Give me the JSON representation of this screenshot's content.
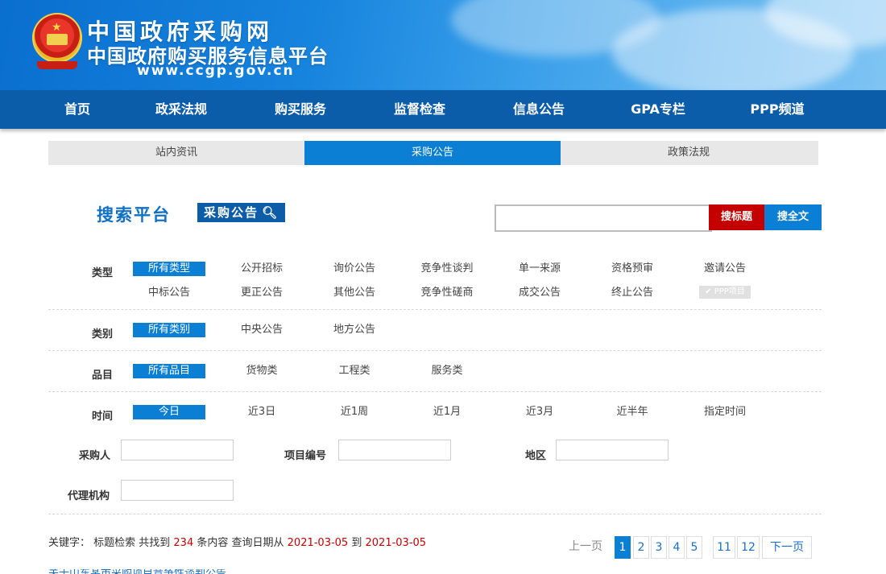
{
  "header": {
    "title": "中国政府采购网",
    "subtitle": "中国政府购买服务信息平台",
    "url": "www.ccgp.gov.cn"
  },
  "nav": [
    "首页",
    "政采法规",
    "购买服务",
    "监督检查",
    "信息公告",
    "GPA专栏",
    "PPP频道"
  ],
  "subtabs": [
    {
      "label": "站内资讯",
      "active": false
    },
    {
      "label": "采购公告",
      "active": true
    },
    {
      "label": "政策法规",
      "active": false
    }
  ],
  "search": {
    "platform_label": "搜索平台",
    "badge_label": "采购公告",
    "input_value": "",
    "btn_title": "搜标题",
    "btn_full": "搜全文"
  },
  "filters": {
    "type": {
      "label": "类型",
      "row1": [
        "所有类型",
        "公开招标",
        "询价公告",
        "竞争性谈判",
        "单一来源",
        "资格预审",
        "邀请公告"
      ],
      "row2": [
        "中标公告",
        "更正公告",
        "其他公告",
        "竞争性磋商",
        "成交公告",
        "终止公告"
      ],
      "ppp_label": "PPP项目"
    },
    "category": {
      "label": "类别",
      "options": [
        "所有类别",
        "中央公告",
        "地方公告"
      ]
    },
    "item": {
      "label": "品目",
      "options": [
        "所有品目",
        "货物类",
        "工程类",
        "服务类"
      ]
    },
    "time": {
      "label": "时间",
      "options": [
        "今日",
        "近3日",
        "近1周",
        "近1月",
        "近3月",
        "近半年",
        "指定时间"
      ]
    }
  },
  "fields": {
    "purchaser": {
      "label": "采购人",
      "value": ""
    },
    "project_no": {
      "label": "项目编号",
      "value": ""
    },
    "region": {
      "label": "地区",
      "value": ""
    },
    "agency": {
      "label": "代理机构",
      "value": ""
    }
  },
  "summary": {
    "prefix": "关键字：  标题检索 共找到",
    "count": "234",
    "mid": "条内容 查询日期从",
    "date_from": "2021-03-05",
    "to": "到",
    "date_to": "2021-03-05"
  },
  "pagination": {
    "prev": "上一页",
    "pages": [
      "1",
      "2",
      "3",
      "4",
      "5",
      "11",
      "12"
    ],
    "current": "1",
    "next": "下一页"
  },
  "first_result_partial": "关于山东某市采购项目竞争性谈判公告"
}
